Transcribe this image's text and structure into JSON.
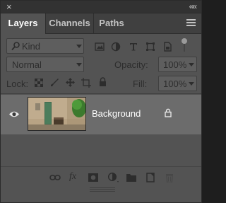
{
  "window": {
    "close_glyph": "×",
    "collapse_glyph": "««"
  },
  "tabs": [
    {
      "label": "Layers",
      "active": true
    },
    {
      "label": "Channels",
      "active": false
    },
    {
      "label": "Paths",
      "active": false
    }
  ],
  "filter": {
    "kind_label": "Kind",
    "icons": [
      "pixel-filter-icon",
      "adjustment-filter-icon",
      "type-filter-icon",
      "shape-filter-icon",
      "smart-object-filter-icon"
    ]
  },
  "blend": {
    "mode": "Normal",
    "opacity_label": "Opacity:",
    "opacity_value": "100%"
  },
  "lock": {
    "label": "Lock:",
    "icons": [
      "lock-transparent-icon",
      "lock-image-icon",
      "lock-position-icon",
      "lock-artboard-icon",
      "lock-all-icon"
    ],
    "fill_label": "Fill:",
    "fill_value": "100%"
  },
  "layers": [
    {
      "name": "Background",
      "visible": true,
      "locked": true
    }
  ],
  "footer_icons": [
    "link-icon",
    "fx-icon",
    "mask-icon",
    "adjustment-layer-icon",
    "group-folder-icon",
    "new-layer-icon",
    "trash-icon"
  ],
  "footer": {
    "fx_label": "fx"
  },
  "colors": {
    "panel": "#535353",
    "tab_bar": "#404040",
    "selected_row": "#6c6c6c",
    "top_bar": "#323232"
  }
}
